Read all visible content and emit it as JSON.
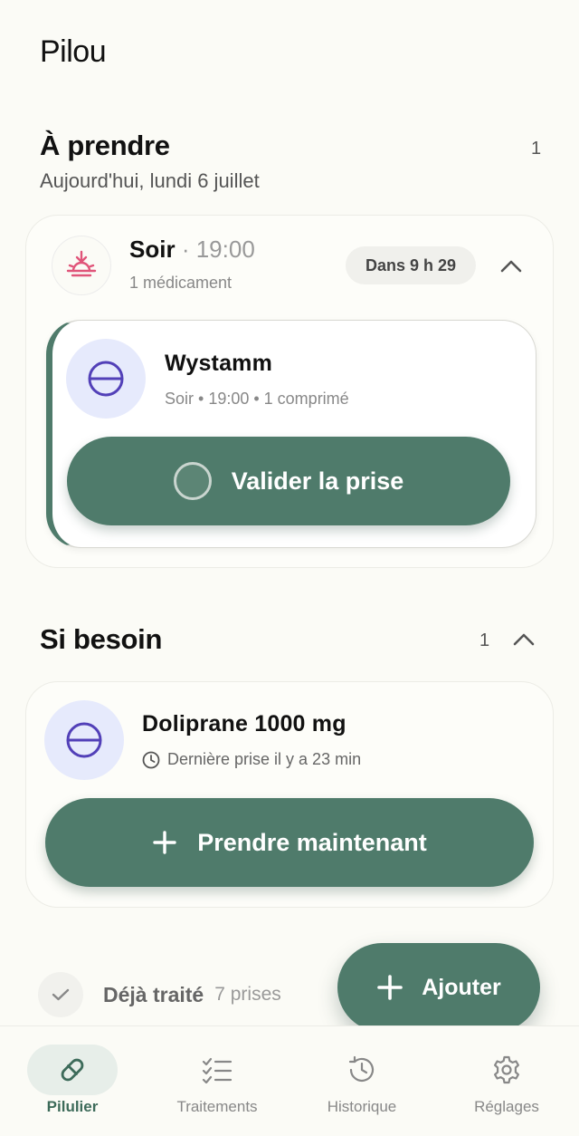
{
  "app": {
    "title": "Pilou"
  },
  "to_take": {
    "title": "À prendre",
    "count": "1",
    "date": "Aujourd'hui, lundi 6 juillet",
    "slot": {
      "name": "Soir",
      "separator": "·",
      "time": "19:00",
      "subtitle": "1 médicament",
      "countdown": "Dans 9 h 29",
      "icon": "sunset-icon"
    },
    "medication": {
      "name": "Wystamm",
      "details": "Soir • 19:00 • 1 comprimé",
      "icon": "pill-icon",
      "action_label": "Valider la prise"
    }
  },
  "as_needed": {
    "title": "Si besoin",
    "count": "1",
    "medication": {
      "name": "Doliprane 1000 mg",
      "last_taken": "Dernière prise il y a 23 min",
      "icon": "pill-icon",
      "action_label": "Prendre maintenant"
    }
  },
  "done": {
    "label": "Déjà traité",
    "count": "7 prises"
  },
  "fab": {
    "label": "Ajouter"
  },
  "nav": {
    "items": [
      {
        "label": "Pilulier",
        "icon": "pill-capsule-icon",
        "active": true
      },
      {
        "label": "Traitements",
        "icon": "checklist-icon",
        "active": false
      },
      {
        "label": "Historique",
        "icon": "history-icon",
        "active": false
      },
      {
        "label": "Réglages",
        "icon": "gear-icon",
        "active": false
      }
    ]
  },
  "colors": {
    "background": "#fbfbf6",
    "accent": "#4f7b6b",
    "pill_bg": "#e6eafc",
    "pill_stroke": "#5240b8",
    "sunset": "#e0557a"
  }
}
